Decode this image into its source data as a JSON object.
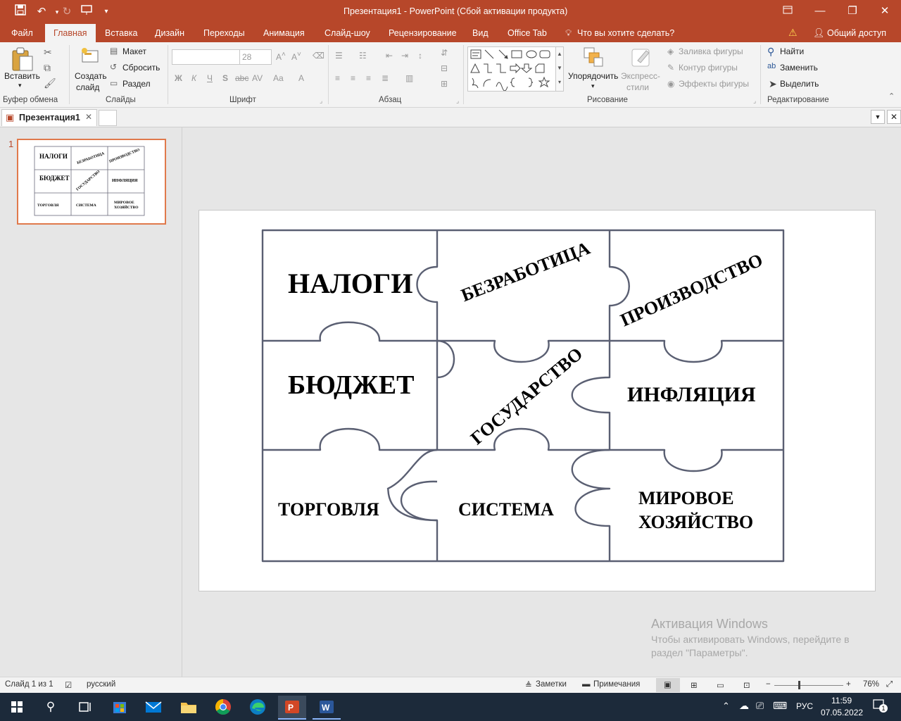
{
  "window": {
    "title": "Презентация1 - PowerPoint (Сбой активации продукта)",
    "colors": {
      "accent": "#b7472a",
      "taskbar": "#1c2a3a"
    }
  },
  "menu": {
    "tabs": [
      "Файл",
      "Главная",
      "Вставка",
      "Дизайн",
      "Переходы",
      "Анимация",
      "Слайд-шоу",
      "Рецензирование",
      "Вид",
      "Office Tab"
    ],
    "active_tab": "Главная",
    "tell_me": "Что вы хотите сделать?",
    "share": "Общий доступ"
  },
  "ribbon": {
    "clipboard": {
      "label": "Буфер обмена",
      "paste": "Вставить"
    },
    "slides": {
      "label": "Слайды",
      "new_slide_1": "Создать",
      "new_slide_2": "слайд",
      "layout": "Макет",
      "reset": "Сбросить",
      "section": "Раздел"
    },
    "font": {
      "label": "Шрифт",
      "font_size": "28",
      "bold": "Ж",
      "italic": "К",
      "underline": "Ч",
      "shadow": "S",
      "strike": "abc"
    },
    "paragraph": {
      "label": "Абзац"
    },
    "drawing": {
      "label": "Рисование",
      "arrange": "Упорядочить",
      "quick_styles_1": "Экспресс-",
      "quick_styles_2": "стили",
      "fill": "Заливка фигуры",
      "outline": "Контур фигуры",
      "effects": "Эффекты фигуры"
    },
    "editing": {
      "label": "Редактирование",
      "find": "Найти",
      "replace": "Заменить",
      "select": "Выделить"
    }
  },
  "doc_tab": {
    "name": "Презентация1"
  },
  "thumbnail": {
    "number": "1"
  },
  "slide": {
    "words": {
      "nalogi": "НАЛОГИ",
      "bezrabotica": "БЕЗРАБОТИЦА",
      "proizvodstvo": "ПРОИЗВОДСТВО",
      "byudzhet": "БЮДЖЕТ",
      "gosudarstvo": "ГОСУДАРСТВО",
      "inflyaciya": "ИНФЛЯЦИЯ",
      "torgovlya": "ТОРГОВЛЯ",
      "sistema": "СИСТЕМА",
      "mirovoe": "МИРОВОЕ",
      "hozyaystvo": "ХОЗЯЙСТВО"
    }
  },
  "watermark": {
    "title": "Активация Windows",
    "line1": "Чтобы активировать Windows, перейдите в",
    "line2": "раздел \"Параметры\"."
  },
  "status": {
    "slide_of": "Слайд 1 из 1",
    "language": "русский",
    "notes": "Заметки",
    "comments": "Примечания",
    "zoom": "76%"
  },
  "taskbar": {
    "lang": "РУС",
    "time": "11:59",
    "date": "07.05.2022",
    "notif_count": "1"
  }
}
